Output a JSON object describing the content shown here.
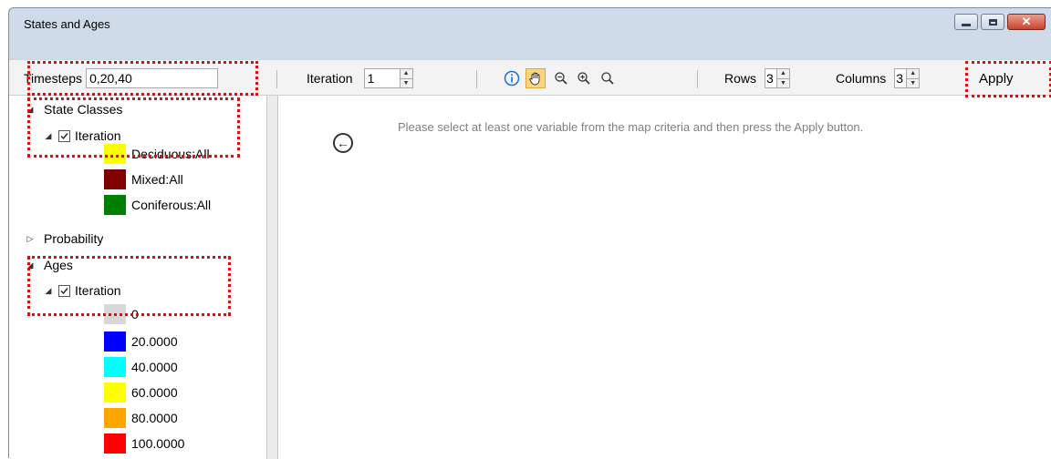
{
  "window": {
    "title": "States and Ages",
    "controls": {
      "minimize": "minimize-icon",
      "maximize": "maximize-icon",
      "close": "✕"
    }
  },
  "toolbar": {
    "timesteps_label": "Timesteps",
    "timesteps_value": "0,20,40",
    "iteration_label": "Iteration",
    "iteration_value": "1",
    "tools": [
      "info-icon",
      "pan-hand-icon",
      "zoom-out-icon",
      "zoom-in-icon",
      "zoom-extent-icon"
    ],
    "rows_label": "Rows",
    "rows_value": "3",
    "columns_label": "Columns",
    "columns_value": "3",
    "apply_label": "Apply"
  },
  "tree": {
    "state_classes": {
      "label": "State Classes",
      "iteration_label": "Iteration",
      "items": [
        {
          "label": "Deciduous:All",
          "color": "#ffff00"
        },
        {
          "label": "Mixed:All",
          "color": "#800000"
        },
        {
          "label": "Coniferous:All",
          "color": "#008000"
        }
      ]
    },
    "probability_label": "Probability",
    "ages": {
      "label": "Ages",
      "iteration_label": "Iteration",
      "items": [
        {
          "label": "0",
          "color": "#d8d8d8"
        },
        {
          "label": "20.0000",
          "color": "#0000ff"
        },
        {
          "label": "40.0000",
          "color": "#00ffff"
        },
        {
          "label": "60.0000",
          "color": "#ffff00"
        },
        {
          "label": "80.0000",
          "color": "#ffa500"
        },
        {
          "label": "100.0000",
          "color": "#ff0000"
        }
      ]
    }
  },
  "main": {
    "message": "Please select at least one variable from the map criteria and then press the Apply button."
  },
  "highlight_color": "#d41414"
}
